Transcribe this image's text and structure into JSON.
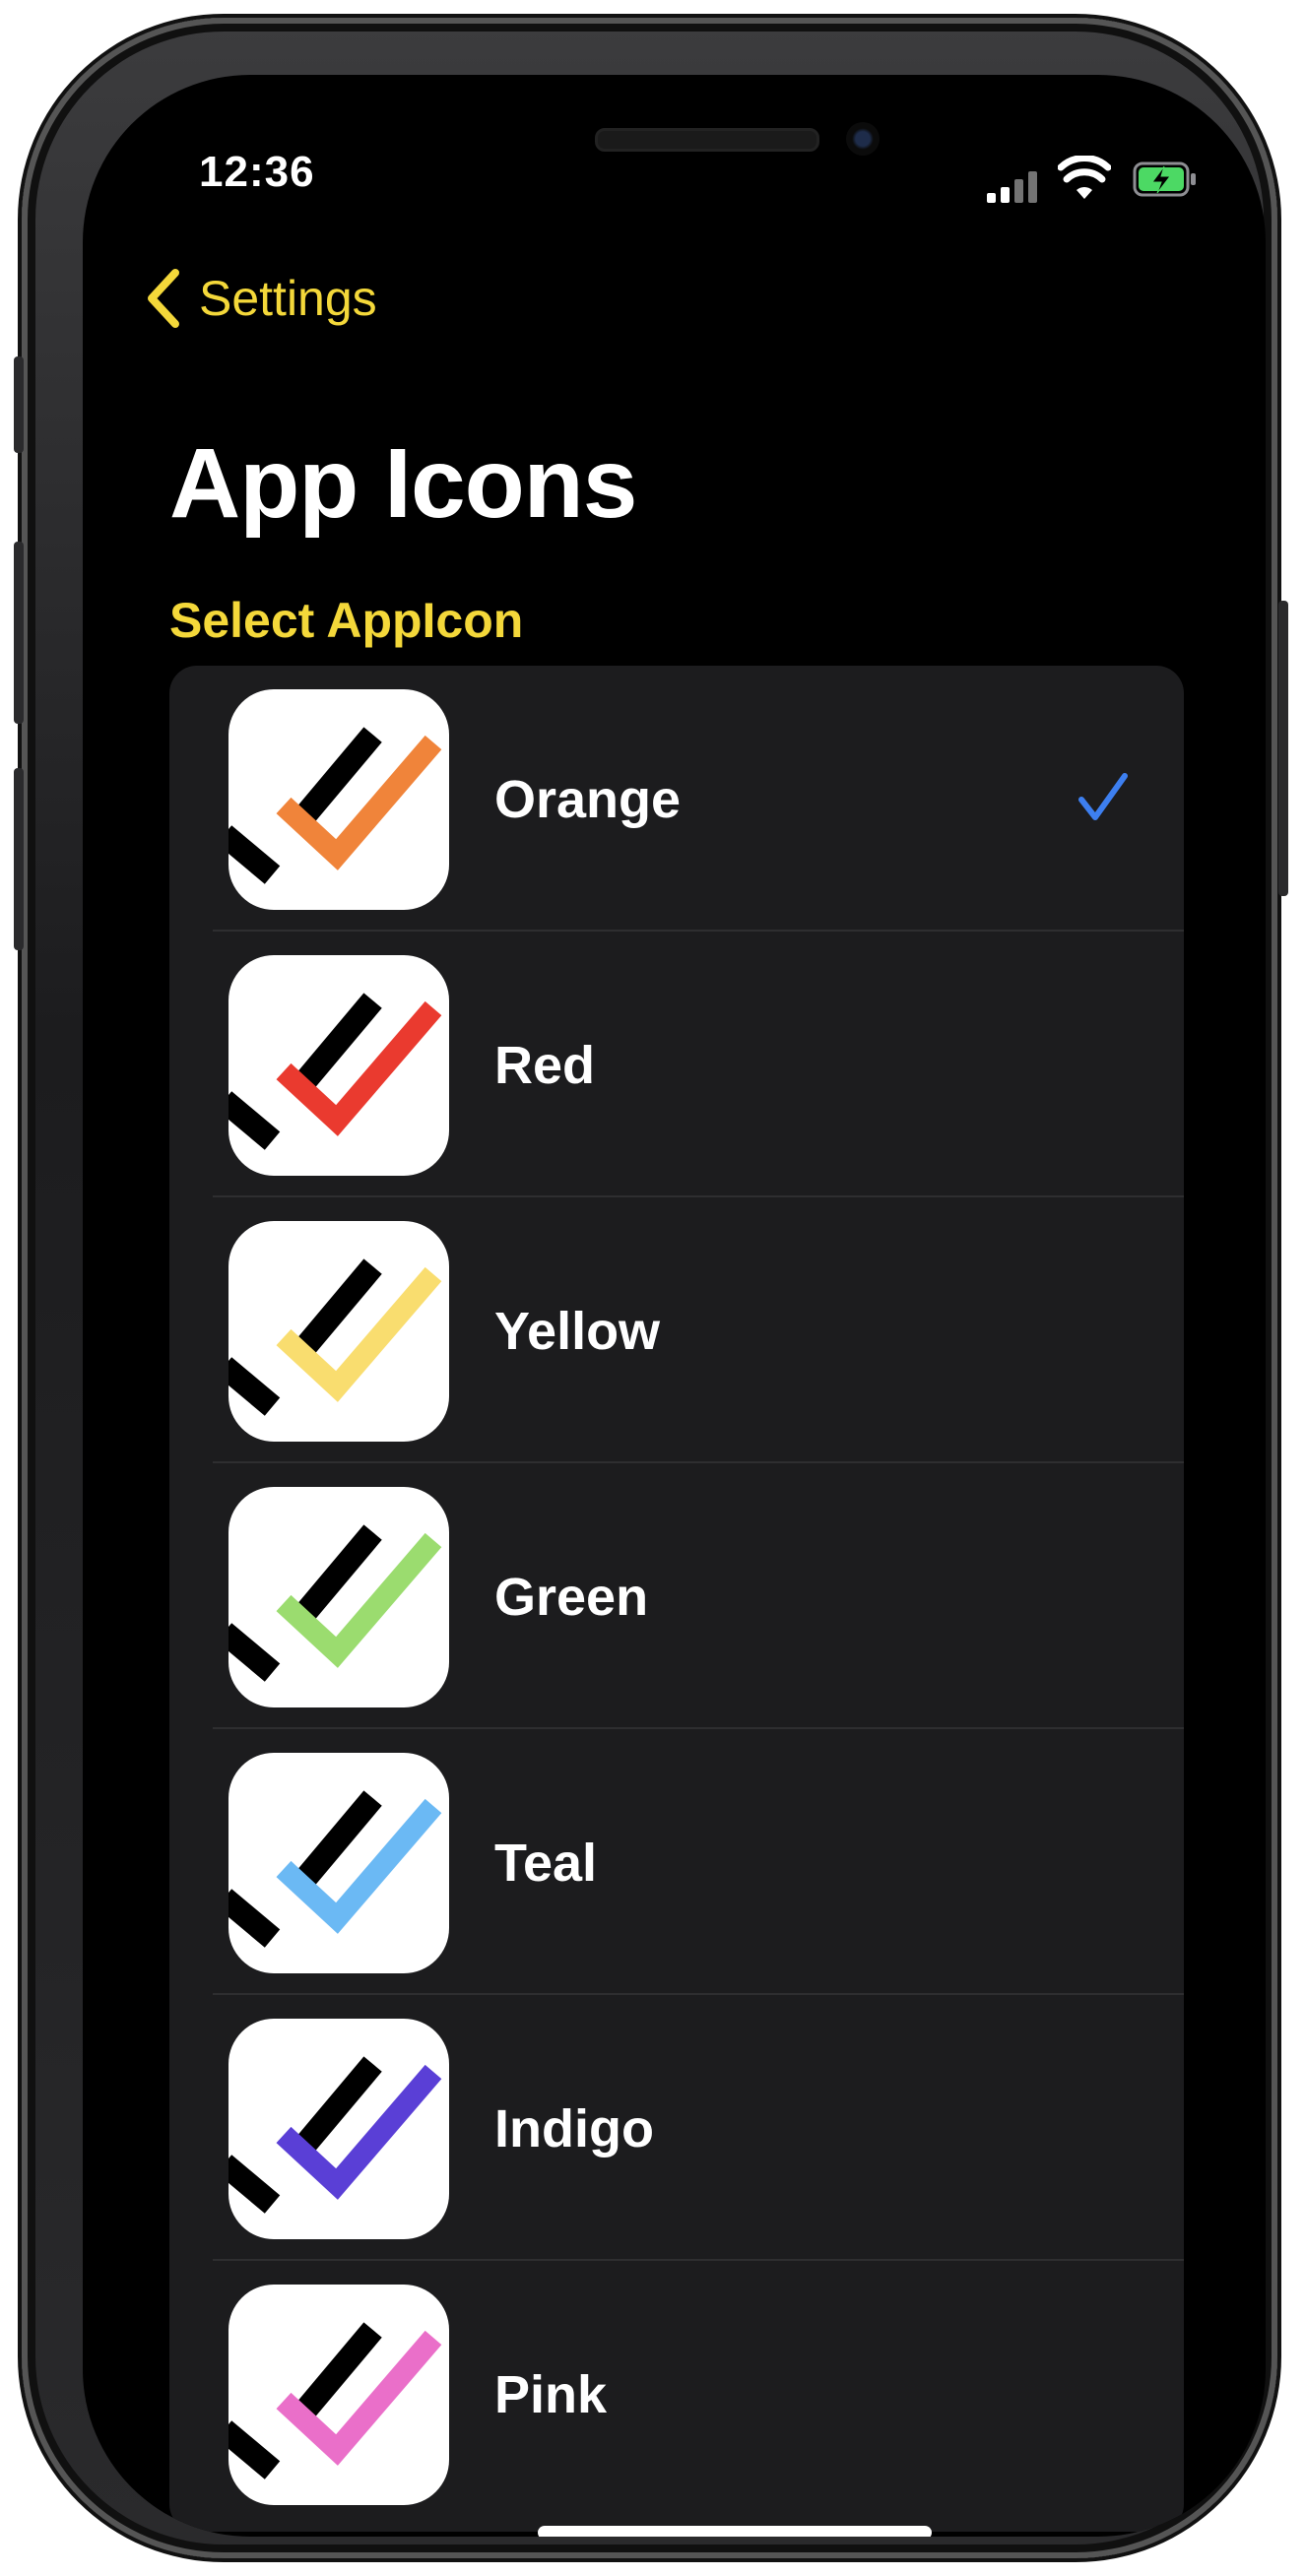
{
  "status_bar": {
    "time": "12:36"
  },
  "nav": {
    "back_label": "Settings"
  },
  "page": {
    "title": "App Icons"
  },
  "section": {
    "header": "Select AppIcon"
  },
  "icons": [
    {
      "label": "Orange",
      "color": "#f0843a",
      "selected": true
    },
    {
      "label": "Red",
      "color": "#ea3a2f",
      "selected": false
    },
    {
      "label": "Yellow",
      "color": "#f9dd6f",
      "selected": false
    },
    {
      "label": "Green",
      "color": "#9bdc6f",
      "selected": false
    },
    {
      "label": "Teal",
      "color": "#6bb9f4",
      "selected": false
    },
    {
      "label": "Indigo",
      "color": "#5a3fd6",
      "selected": false
    },
    {
      "label": "Pink",
      "color": "#ea6fc9",
      "selected": false
    }
  ],
  "colors": {
    "accent": "#f4d83a",
    "check": "#3d7ff0"
  },
  "icon_names": [
    "chevron-left-icon",
    "checkmark-icon",
    "signal-icon",
    "wifi-icon",
    "battery-charging-icon"
  ]
}
